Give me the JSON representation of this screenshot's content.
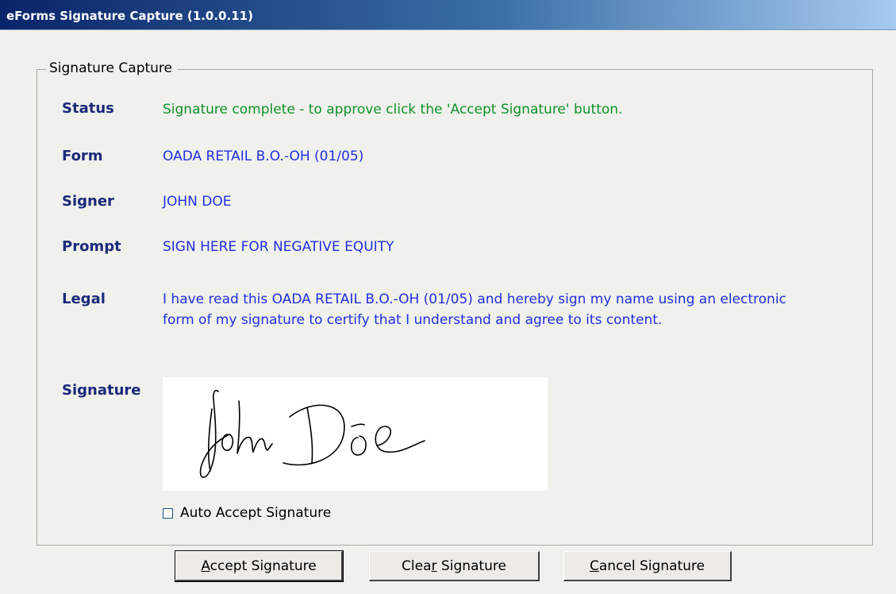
{
  "window": {
    "title": "eForms Signature Capture (1.0.0.11)"
  },
  "group": {
    "legend": "Signature Capture"
  },
  "fields": {
    "status": {
      "label": "Status",
      "value": "Signature complete - to approve click the 'Accept Signature' button."
    },
    "form": {
      "label": "Form",
      "value": "OADA RETAIL B.O.-OH (01/05)"
    },
    "signer": {
      "label": "Signer",
      "value": "JOHN DOE"
    },
    "prompt": {
      "label": "Prompt",
      "value": "SIGN HERE FOR NEGATIVE EQUITY"
    },
    "legal": {
      "label": "Legal",
      "value": "I have read this OADA RETAIL B.O.-OH (01/05) and hereby sign my name using an electronic form of my signature to certify that I understand and agree to its content."
    },
    "signature": {
      "label": "Signature",
      "image": "handwritten signature 'John Doe'"
    }
  },
  "auto_accept": {
    "label": "Auto Accept Signature",
    "checked": false
  },
  "buttons": {
    "accept": {
      "mnemonic": "A",
      "rest": "ccept Signature"
    },
    "clear": {
      "prefix": "Clea",
      "mnemonic": "r",
      "rest": " Signature"
    },
    "cancel": {
      "mnemonic": "C",
      "rest": "ancel Signature"
    }
  },
  "colors": {
    "title_bar_start": "#0a246a",
    "title_bar_end": "#a6caf0",
    "label": "#1a2a7a",
    "value": "#2030e0",
    "status_value": "#10922a",
    "window_bg": "#f0f0ec"
  }
}
